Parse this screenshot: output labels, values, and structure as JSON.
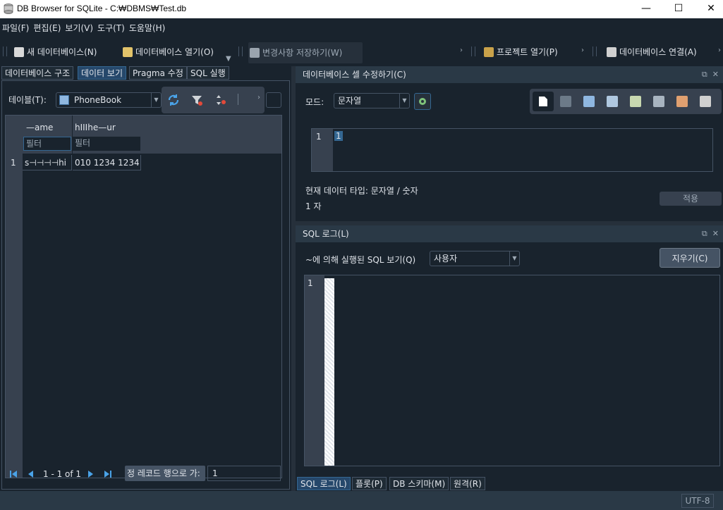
{
  "window": {
    "title": "DB Browser for SQLite - C:₩DBMS₩Test.db",
    "minimize": "—",
    "maximize": "☐",
    "close": "✕"
  },
  "menu": [
    "파일(F)",
    "편집(E)",
    "보기(V)",
    "도구(T)",
    "도움말(H)"
  ],
  "toolbar": {
    "new_db": "새 데이터베이스(N)",
    "open_db": "데이터베이스 열기(O)",
    "write_changes": "변경사항 저장하기(W)",
    "open_project": "프로젝트 열기(P)",
    "attach_db": "데이터베이스 연결(A)"
  },
  "left_tabs": [
    "데이터베이스 구조",
    "데이터 보기",
    "Pragma 수정",
    "SQL 실행"
  ],
  "browse": {
    "table_label": "테이블(T):",
    "table_value": "PhoneBook",
    "columns": [
      "name",
      "phone_num"
    ],
    "column_headers_rendered": [
      "—ame",
      "hⅠⅠⅠhe—ur"
    ],
    "filter_placeholder": "필터",
    "rows": [
      {
        "rownum": "1",
        "cells": [
          "s⊣⊣⊣⊣hi",
          "010 1234 1234"
        ]
      }
    ],
    "pager_text": "1 - 1 of 1",
    "goto_button": "정 레코드 행으로 가:",
    "goto_value": "1"
  },
  "edit_cell": {
    "title": "데이터베이스 셀 수정하기(C)",
    "mode_label": "모드:",
    "mode_value": "문자열",
    "line_number": "1",
    "cell_value": "1",
    "data_type": "현재 데이터 타입: 문자열 / 숫자",
    "size": "1 자",
    "apply": "적용"
  },
  "sql_log": {
    "title": "SQL 로그(L)",
    "label": "~에 의해 실행된 SQL 보기(Q)",
    "submitter": "사용자",
    "clear": "지우기(C)",
    "line_number": "1"
  },
  "bottom_tabs": [
    "SQL 로그(L)",
    "플롯(P)",
    "DB 스키마(M)",
    "원격(R)"
  ],
  "status": {
    "encoding": "UTF-8"
  },
  "colors": {
    "bg": "#19232d",
    "accent": "#26486b",
    "border": "#455364"
  }
}
